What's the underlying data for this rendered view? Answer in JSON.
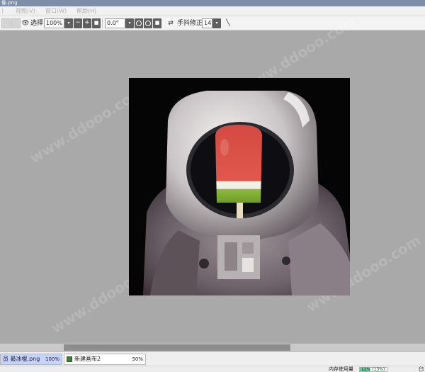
{
  "window": {
    "title": "像.png"
  },
  "menu": [
    {
      "label": ")"
    },
    {
      "label": "视图(V)"
    },
    {
      "label": "窗口(W)"
    },
    {
      "label": "帮助(H)"
    }
  ],
  "toolbar": {
    "select_label": "选择",
    "zoom_value": "100%",
    "zoom_out": "−",
    "zoom_in": "+",
    "rotation_value": "0.0°",
    "stabilizer_label": "手抖修正",
    "stabilizer_value": "14"
  },
  "tabs": [
    {
      "name": "员 最冰棍.png",
      "zoom": "100%",
      "active": true
    },
    {
      "name": "新建画布2",
      "zoom": "50%",
      "active": false
    }
  ],
  "status": {
    "memory_label": "内存使用量",
    "memory_text": "12% (13%)",
    "memory_fraction": 0.12,
    "tail": "臼"
  },
  "watermark": {
    "text": "www.ddooo.com"
  },
  "colors": {
    "accent": "#c6d3ff",
    "memory": "#4fd18f",
    "canvas_bg": "#a9a9a9"
  }
}
